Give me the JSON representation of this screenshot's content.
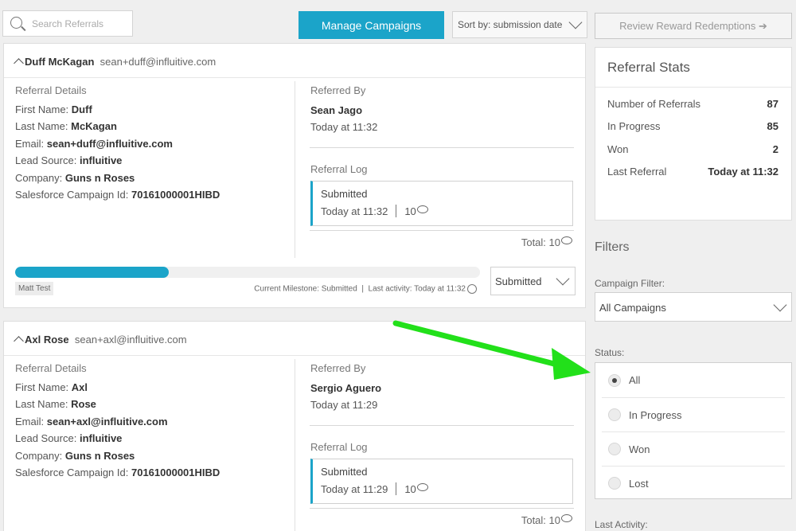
{
  "search": {
    "placeholder": "Search Referrals"
  },
  "toolbar": {
    "manage_label": "Manage Campaigns",
    "sort_label": "Sort by: submission date",
    "review_label": "Review Reward Redemptions ➔"
  },
  "referrals": [
    {
      "name": "Duff McKagan",
      "email_head": "sean+duff@influitive.com",
      "details_heading": "Referral Details",
      "first_name_label": "First Name:",
      "first_name": "Duff",
      "last_name_label": "Last Name:",
      "last_name": "McKagan",
      "email_label": "Email:",
      "email": "sean+duff@influitive.com",
      "lead_label": "Lead Source:",
      "lead": "influitive",
      "company_label": "Company:",
      "company": "Guns n Roses",
      "sfid_label": "Salesforce Campaign Id:",
      "sfid": "70161000001HIBD",
      "referred_by_heading": "Referred By",
      "referrer": "Sean Jago",
      "referred_time": "Today at 11:32",
      "log_heading": "Referral Log",
      "log_status": "Submitted",
      "log_time": "Today at 11:32",
      "log_points": "10",
      "total": "Total: 10",
      "progress": 0.33,
      "owner": "Matt Test",
      "milestone": "Current Milestone: Submitted  |  Last activity: Today at 11:32",
      "status_value": "Submitted"
    },
    {
      "name": "Axl Rose",
      "email_head": "sean+axl@influitive.com",
      "details_heading": "Referral Details",
      "first_name_label": "First Name:",
      "first_name": "Axl",
      "last_name_label": "Last Name:",
      "last_name": "Rose",
      "email_label": "Email:",
      "email": "sean+axl@influitive.com",
      "lead_label": "Lead Source:",
      "lead": "influitive",
      "company_label": "Company:",
      "company": "Guns n Roses",
      "sfid_label": "Salesforce Campaign Id:",
      "sfid": "70161000001HIBD",
      "referred_by_heading": "Referred By",
      "referrer": "Sergio Aguero",
      "referred_time": "Today at 11:29",
      "log_heading": "Referral Log",
      "log_status": "Submitted",
      "log_time": "Today at 11:29",
      "log_points": "10",
      "total": "Total: 10"
    }
  ],
  "stats": {
    "title": "Referral Stats",
    "rows": [
      {
        "label": "Number of Referrals",
        "value": "87"
      },
      {
        "label": "In Progress",
        "value": "85"
      },
      {
        "label": "Won",
        "value": "2"
      },
      {
        "label": "Last Referral",
        "value": "Today at 11:32"
      }
    ]
  },
  "filters": {
    "title": "Filters",
    "campaign_label": "Campaign Filter:",
    "campaign_value": "All Campaigns",
    "status_label": "Status:",
    "status_options": [
      "All",
      "In Progress",
      "Won",
      "Lost"
    ],
    "status_selected": "All",
    "last_activity_label": "Last Activity:"
  },
  "annotation": {
    "arrow_color": "#22e01a"
  },
  "colors": {
    "accent": "#1ba4c9"
  }
}
